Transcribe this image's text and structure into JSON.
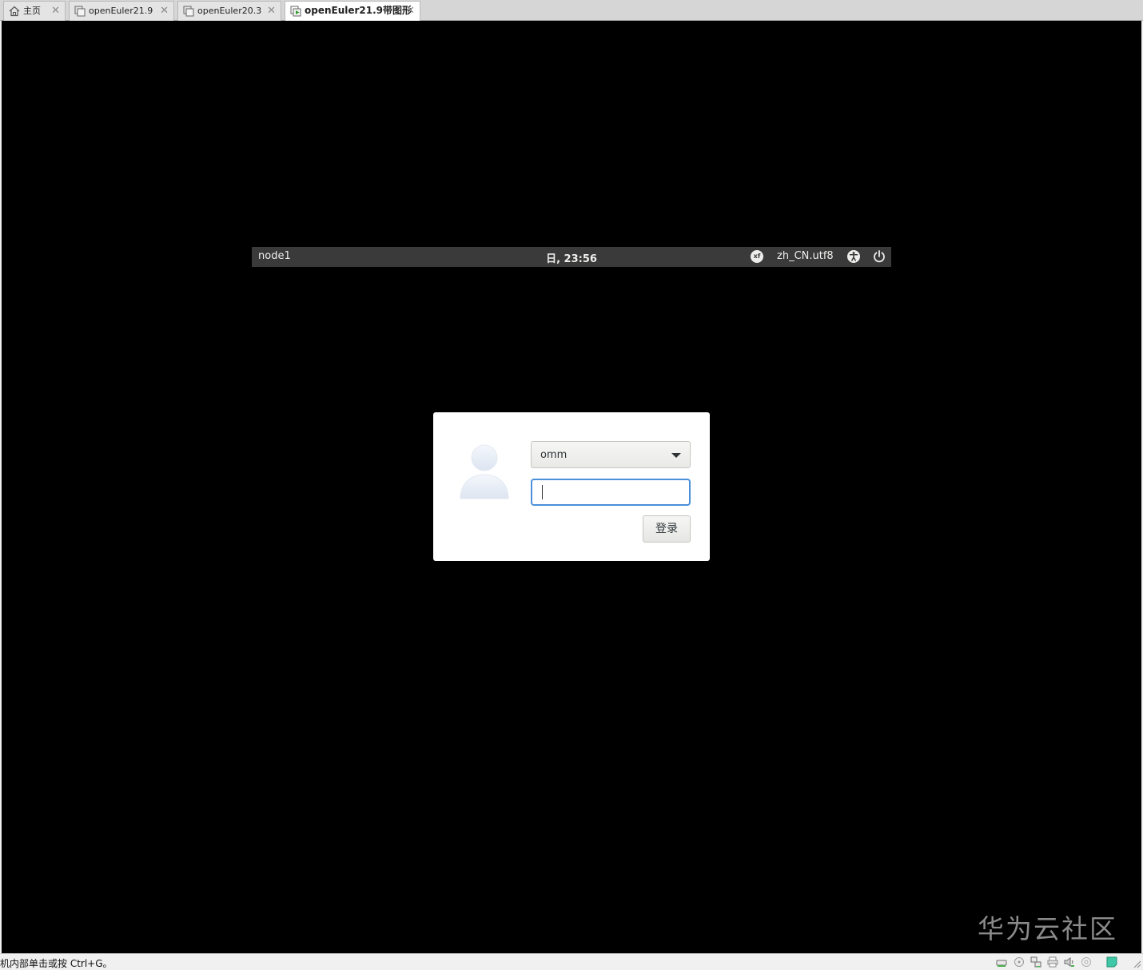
{
  "tabs": [
    {
      "label": "主页",
      "icon": "home-icon",
      "active": false
    },
    {
      "label": "openEuler21.9",
      "icon": "vm-icon",
      "active": false
    },
    {
      "label": "openEuler20.3",
      "icon": "vm-icon",
      "active": false
    },
    {
      "label": "openEuler21.9带图形",
      "icon": "vm-running-icon",
      "active": true
    }
  ],
  "gdm_topbar": {
    "hostname": "node1",
    "clock": "日, 23:56",
    "keyboard_layout": "xf",
    "locale": "zh_CN.utf8",
    "accessibility_icon": "accessibility-icon",
    "power_icon": "power-icon"
  },
  "login": {
    "username": "omm",
    "password_value": "",
    "login_button": "登录"
  },
  "watermark": "华为云社区",
  "statusbar": {
    "text": "机内部单击或按 Ctrl+G。",
    "tray_icons": [
      "hard-disk-icon",
      "cd-icon",
      "network-icon",
      "printer-icon",
      "sound-icon",
      "usb-icon",
      "message-icon"
    ]
  },
  "colors": {
    "vm_background": "#000000",
    "gdm_topbar": "#3a3a3a",
    "focus_border": "#4a90d9"
  }
}
